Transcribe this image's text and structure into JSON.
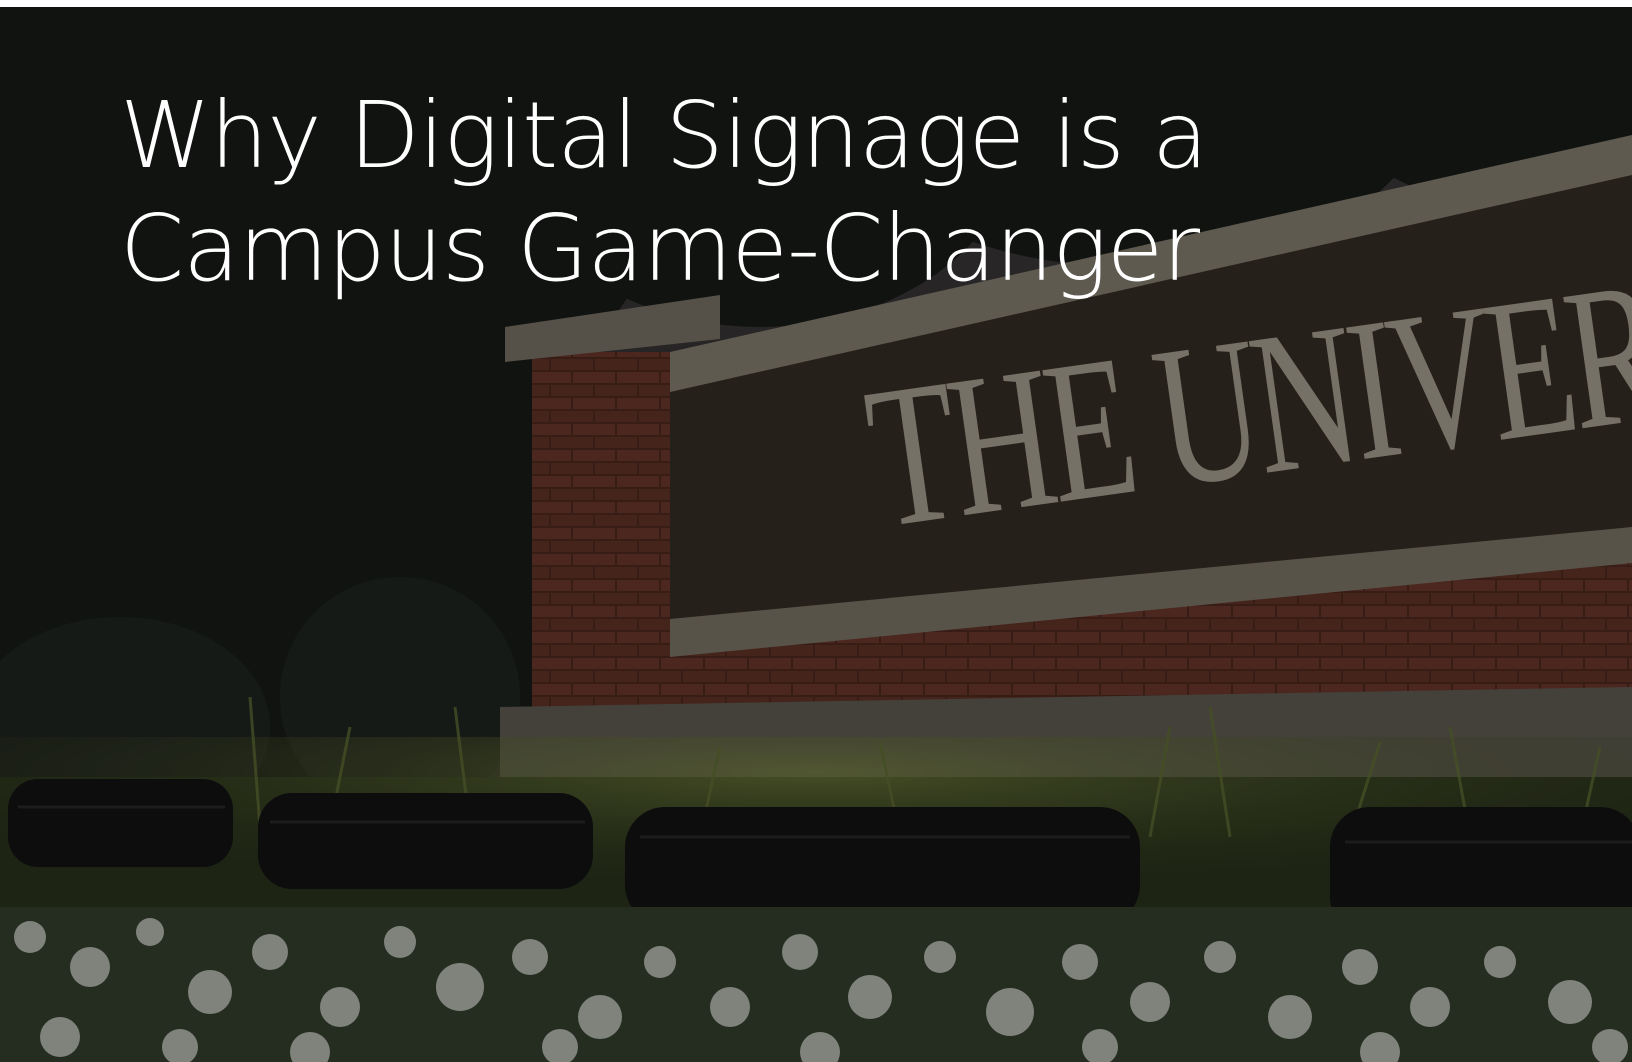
{
  "hero": {
    "title_line_1": "Why Digital Signage is a",
    "title_line_2": "Campus Game-Changer",
    "sign_text": "THE UNIVERSITY"
  },
  "colors": {
    "title": "#ffffff",
    "sky": "#3a3638",
    "brick": "#6a3a2c",
    "sign_panel": "#3e342c",
    "flowers": "#d8dcd2",
    "lights": "#1a1a1c"
  }
}
